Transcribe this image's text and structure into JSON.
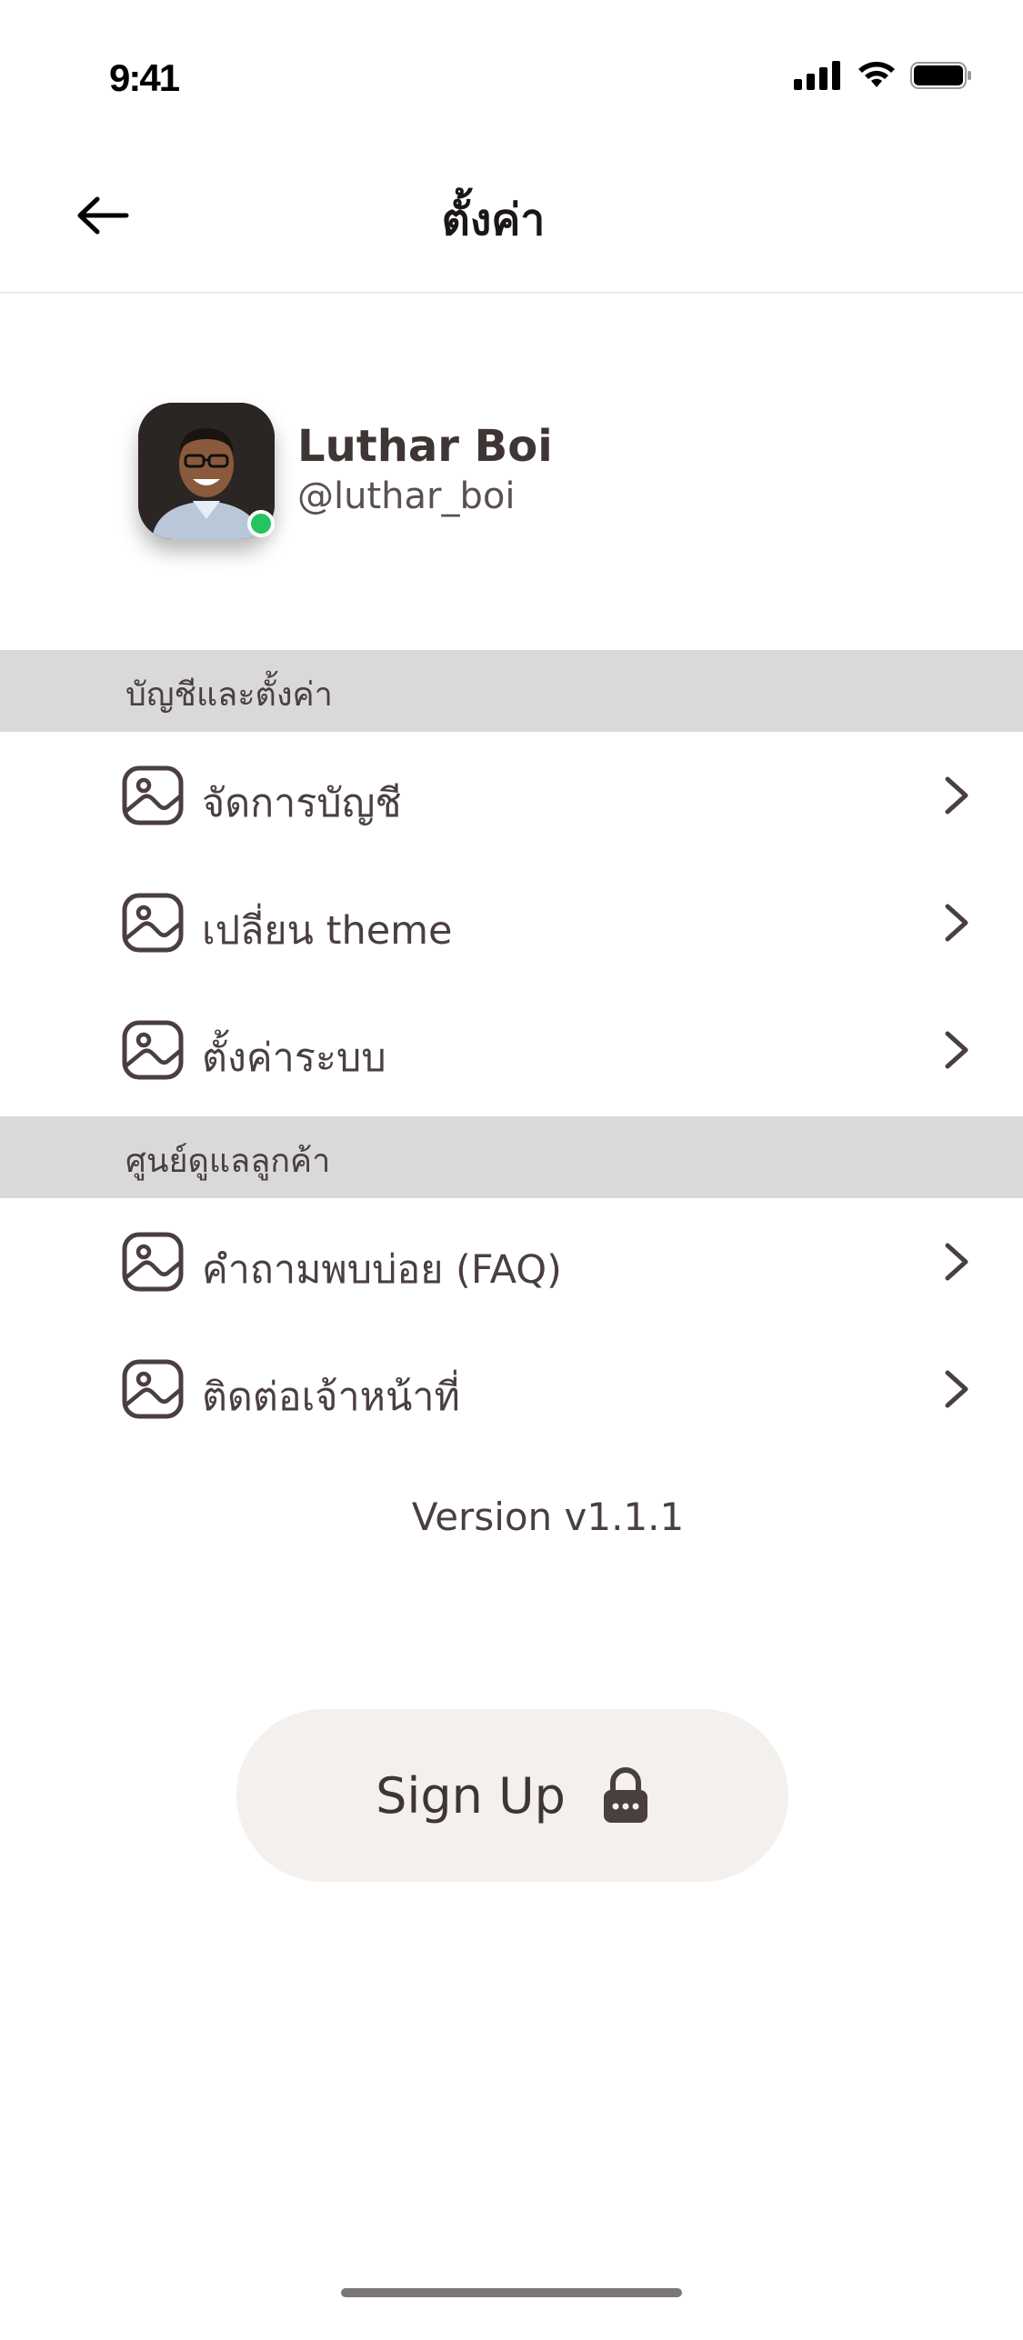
{
  "status_bar": {
    "time": "9:41"
  },
  "nav": {
    "title": "ตั้งค่า"
  },
  "profile": {
    "name": "Luthar Boi",
    "handle": "@luthar_boi",
    "status_color": "#22c55e"
  },
  "sections": [
    {
      "title": "บัญชีและตั้งค่า",
      "items": [
        {
          "label": "จัดการบัญชี",
          "icon": "image-icon"
        },
        {
          "label": "เปลี่ยน theme",
          "icon": "image-icon"
        },
        {
          "label": "ตั้งค่าระบบ",
          "icon": "image-icon"
        }
      ]
    },
    {
      "title": "ศูนย์ดูแลลูกค้า",
      "items": [
        {
          "label": "คำถามพบบ่อย (FAQ)",
          "icon": "image-icon"
        },
        {
          "label": "ติดต่อเจ้าหน้าที่",
          "icon": "image-icon"
        }
      ]
    }
  ],
  "version": "Version v1.1.1",
  "signup": {
    "label": "Sign Up",
    "icon": "lock-icon"
  },
  "colors": {
    "text": "#4a3f3f",
    "section_bg": "#d9d9d9",
    "button_bg": "#f4f0ee"
  }
}
